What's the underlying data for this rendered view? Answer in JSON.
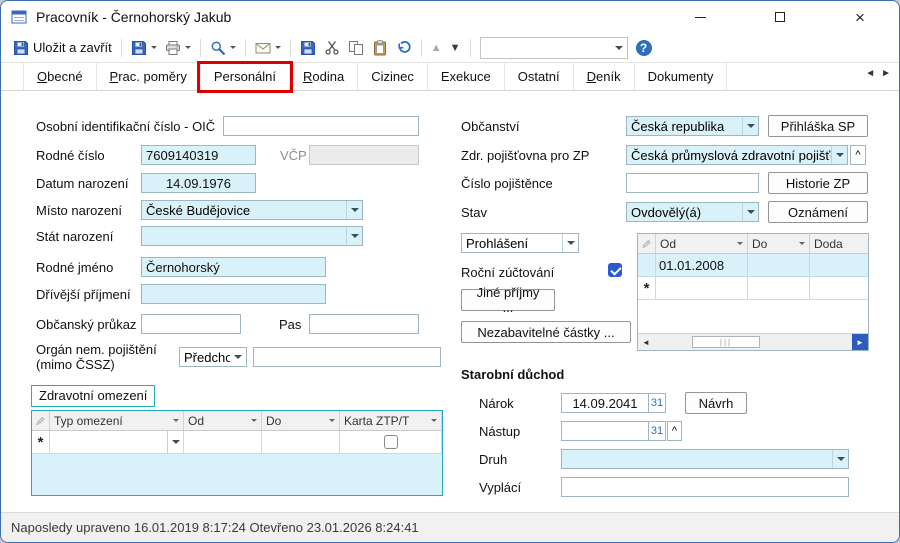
{
  "colors": {
    "field_blue": "#d9f1f8",
    "grid_teal": "#1fadc4",
    "highlight_red": "#dd0000",
    "checkbox_blue": "#2a59d1",
    "icon_blue": "#2d6fbd"
  },
  "window": {
    "title": "Pracovník - Černohorský Jakub"
  },
  "toolbar": {
    "save_close_label": "Uložit a zavřít",
    "combo_value": ""
  },
  "tabs": {
    "items": [
      "Obecné",
      "Prac. poměry",
      "Personální",
      "Rodina",
      "Cizinec",
      "Exekuce",
      "Ostatní",
      "Deník",
      "Dokumenty"
    ],
    "selected": "Personální"
  },
  "form": {
    "left": {
      "oic_label": "Osobní identifikační číslo - OIČ",
      "oic_value": "",
      "rodne_cislo_label": "Rodné číslo",
      "rodne_cislo_value": "7609140319",
      "vcp_label": "VČP",
      "vcp_value": "",
      "datum_narozeni_label": "Datum narození",
      "datum_narozeni_value": "14.09.1976",
      "misto_narozeni_label": "Místo narození",
      "misto_narozeni_value": "České Budějovice",
      "stat_narozeni_label": "Stát narození",
      "stat_narozeni_value": "",
      "rodne_jmeno_label": "Rodné jméno",
      "rodne_jmeno_value": "Černohorský",
      "drivejsi_prijmeni_label": "Dřívější příjmení",
      "drivejsi_prijmeni_value": "",
      "obcansky_prukaz_label": "Občanský průkaz",
      "obcansky_prukaz_value": "",
      "pas_label": "Pas",
      "pas_value": "",
      "organ_label_1": "Orgán nem. pojištění",
      "organ_label_2": "(mimo ČSSZ)",
      "organ_select_value": "Předchozí",
      "organ_value": "",
      "zdravotni_omezeni_label": "Zdravotní omezení",
      "omezeni_grid": {
        "columns": [
          "Typ omezení",
          "Od",
          "Do",
          "Karta ZTP/T"
        ],
        "new_row_marker": "*",
        "karta_checked": false
      }
    },
    "right": {
      "obcanstvi_label": "Občanství",
      "obcanstvi_value": "Česká republika",
      "prihlaska_sp_button": "Přihláška SP",
      "zdr_pojistovna_label": "Zdr. pojišťovna pro ZP",
      "zdr_pojistovna_value": "Česká průmyslová zdravotní pojišťo",
      "cislo_pojistence_label": "Číslo pojištěnce",
      "cislo_pojistence_value": "",
      "historie_zp_button": "Historie ZP",
      "stav_label": "Stav",
      "stav_value": "Ovdovělý(á)",
      "oznameni_button": "Oznámení",
      "prohlaseni_value": "Prohlášení",
      "rocni_zuctovani_label": "Roční zúčtování",
      "rocni_zuctovani_checked": true,
      "jine_prijmy_button": "Jiné příjmy ...",
      "nezabavitelne_button": "Nezabavitelné částky ...",
      "prohlaseni_grid": {
        "columns": [
          "Od",
          "Do",
          "Doda"
        ],
        "rows": [
          [
            "01.01.2008",
            "",
            ""
          ]
        ],
        "new_row_marker": "*"
      },
      "starobni_duchod": {
        "title": "Starobní důchod",
        "narok_label": "Nárok",
        "narok_value": "14.09.2041",
        "calendar_button": "31",
        "navrh_button": "Návrh",
        "nastup_label": "Nástup",
        "nastup_value": "",
        "druh_label": "Druh",
        "druh_value": "",
        "vyplaci_label": "Vyplácí",
        "vyplaci_value": ""
      }
    }
  },
  "statusbar": {
    "text": "Naposledy upraveno 16.01.2019 8:17:24 Otevřeno 23.01.2026 8:24:41"
  }
}
